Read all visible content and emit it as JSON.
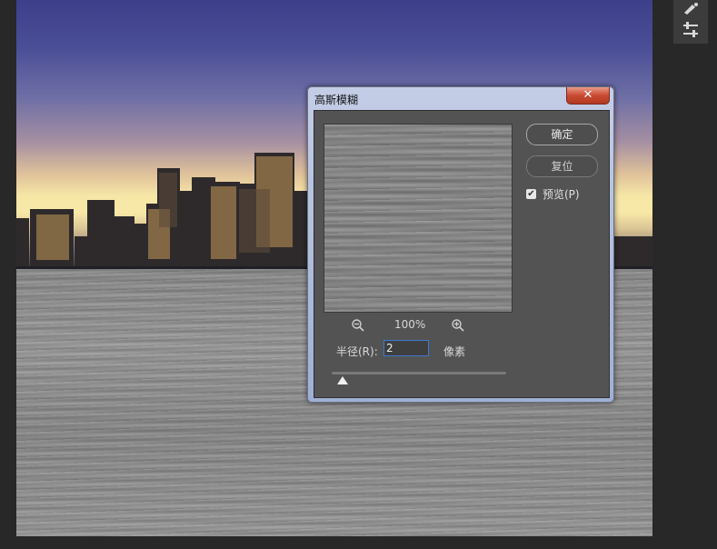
{
  "dialog": {
    "title": "高斯模糊",
    "close_label": "✕",
    "ok_label": "确定",
    "reset_label": "复位",
    "preview_label": "预览(P)",
    "preview_checked": true,
    "zoom_level": "100%",
    "radius_label": "半径(R):",
    "radius_value": "2",
    "radius_unit": "像素",
    "radius_slider_fraction": 0.06
  },
  "toolbar": {
    "icons": [
      "brush-settings-icon",
      "adjustments-sliders-icon"
    ]
  },
  "colors": {
    "app_background": "#282828",
    "dialog_body": "#535353",
    "input_focus": "#3d7ad1"
  }
}
